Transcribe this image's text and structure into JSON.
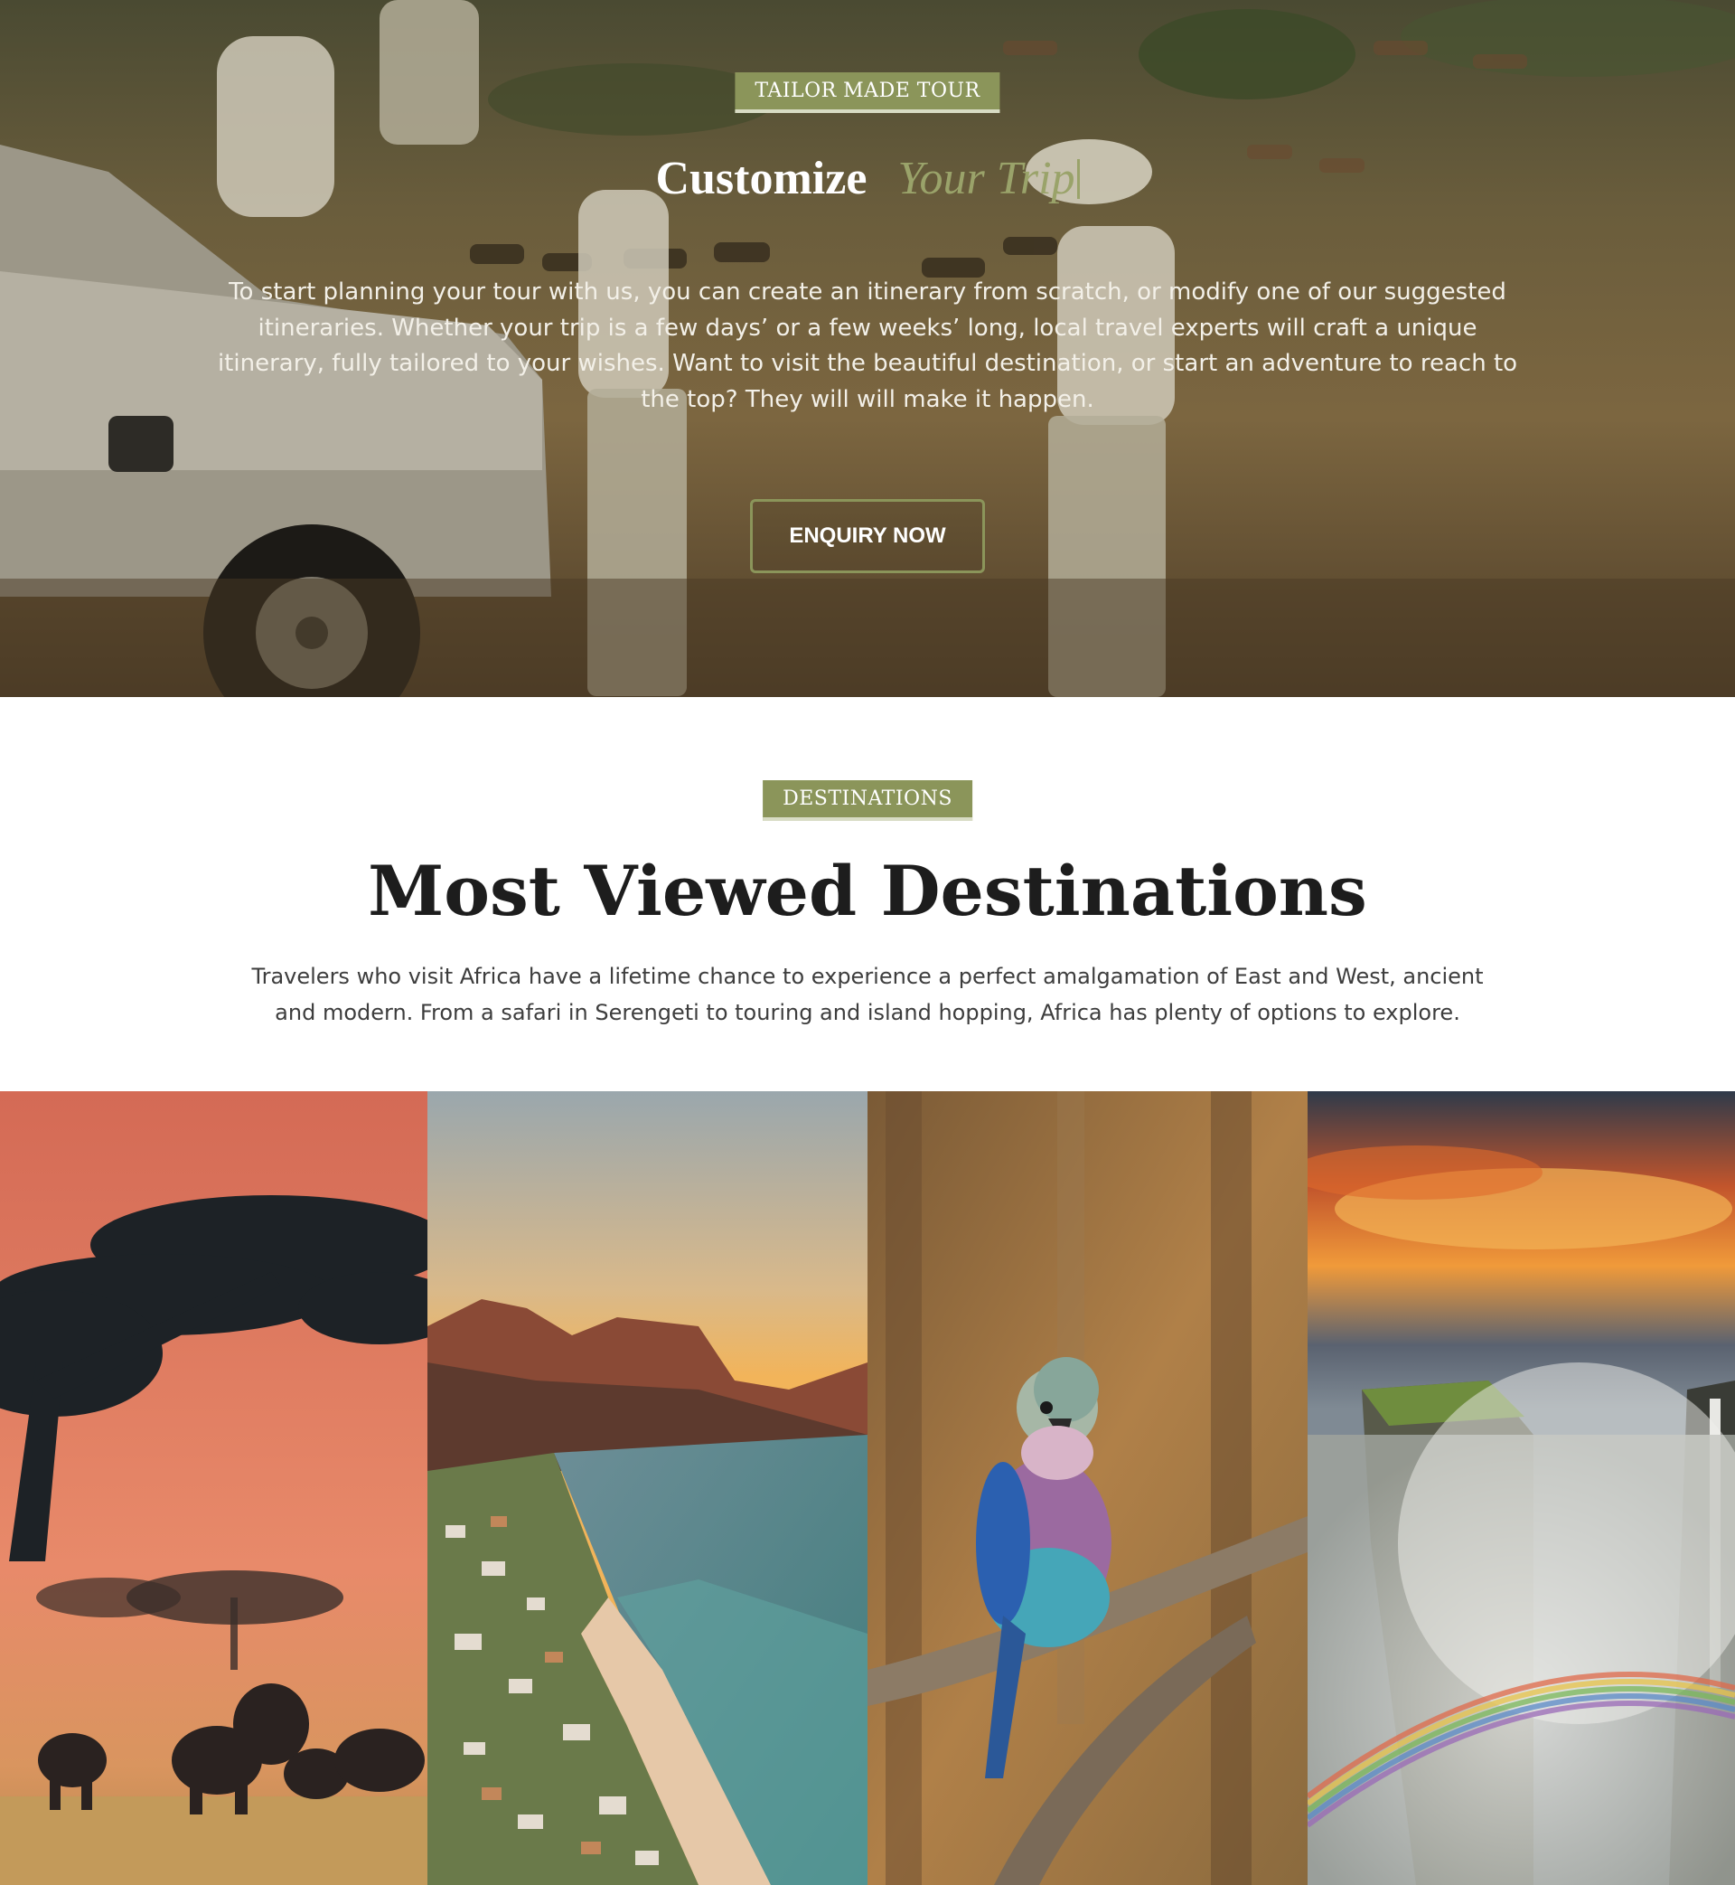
{
  "hero": {
    "tag": "TAILOR MADE TOUR",
    "title_main": "Customize",
    "title_accent": "Your Trip",
    "text": "To start planning your tour with us, you can create an itinerary from scratch, or modify one of our suggested itineraries. Whether your trip is a few days’ or a few weeks’ long, local travel experts will craft a unique itinerary, fully tailored to your wishes. Want to visit the beautiful destination, or start an adventure to reach to the top? They will will make it happen.",
    "button_label": "ENQUIRY NOW"
  },
  "destinations": {
    "tag": "DESTINATIONS",
    "title": "Most Viewed Destinations",
    "text": "Travelers who visit Africa have a lifetime chance to experience a perfect amalgamation of East and West, ancient and modern. From a safari in Serengeti to touring and island hopping, Africa has plenty of options to explore."
  },
  "gallery": {
    "panels": [
      {
        "scene": "savanna-sunset-elephants"
      },
      {
        "scene": "coastal-mountain-town"
      },
      {
        "scene": "lilac-breasted-roller"
      },
      {
        "scene": "waterfall-rainbow"
      }
    ]
  },
  "colors": {
    "accent_olive": "#8b955a",
    "accent_olive_light": "#9aa36a",
    "text_dark": "#1d1d1d"
  }
}
